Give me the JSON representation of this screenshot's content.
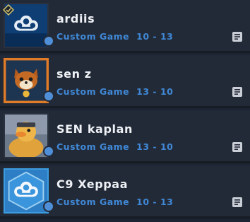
{
  "friends": [
    {
      "name": "ardiis",
      "mode": "Custom Game",
      "score": "10 - 13",
      "avatar": "cloud9-icon",
      "rank_badge": "rank-diamond-icon"
    },
    {
      "name": "sen z",
      "mode": "Custom Game",
      "score": "13 - 10",
      "avatar": "fox-mascot-icon"
    },
    {
      "name": "SEN kaplan",
      "mode": "Custom Game",
      "score": "13 - 10",
      "avatar": "duck-mascot-icon"
    },
    {
      "name": "C9 Xeppaa",
      "mode": "Custom Game",
      "score": "10 - 13",
      "avatar": "cloud9-icon"
    }
  ],
  "colors": {
    "status_blue": "#3f88d6",
    "online_dot": "#4f8fd8",
    "row_bg": "#232a37"
  },
  "icons": {
    "note": "note-icon",
    "online": "online-status-dot"
  }
}
